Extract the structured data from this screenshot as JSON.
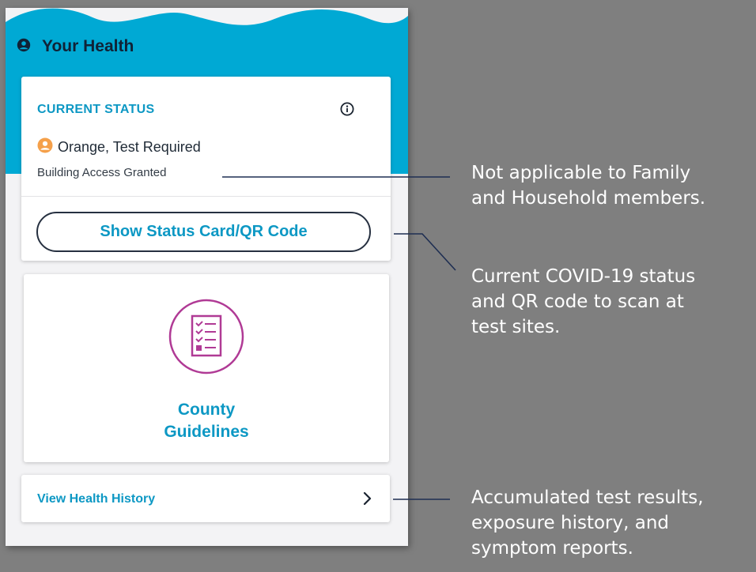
{
  "header": {
    "title": "Your Health"
  },
  "status_card": {
    "label": "CURRENT STATUS",
    "status": "Orange, Test Required",
    "access": "Building Access Granted",
    "button": "Show Status Card/QR Code"
  },
  "guidelines_card": {
    "line1": "County",
    "line2": "Guidelines"
  },
  "history_card": {
    "label": "View Health History"
  },
  "annotations": {
    "note1_line1": "Not applicable to Family",
    "note1_line2": "and Household members.",
    "note2_line1": "Current COVID-19 status",
    "note2_line2": "and QR code to scan at",
    "note2_line3": "test sites.",
    "note3_line1": "Accumulated test results,",
    "note3_line2": "exposure history, and",
    "note3_line3": "symptom reports."
  },
  "colors": {
    "header_blue": "#00a9d4",
    "accent_text": "#0d98c4",
    "status_orange": "#f5a04a",
    "guidelines_magenta": "#b03a95",
    "background": "#7f7f7f"
  },
  "icons": {
    "header": "user-circle-icon",
    "info": "info-icon",
    "status": "user-circle-icon",
    "guidelines": "checklist-icon",
    "history": "chevron-right-icon"
  }
}
